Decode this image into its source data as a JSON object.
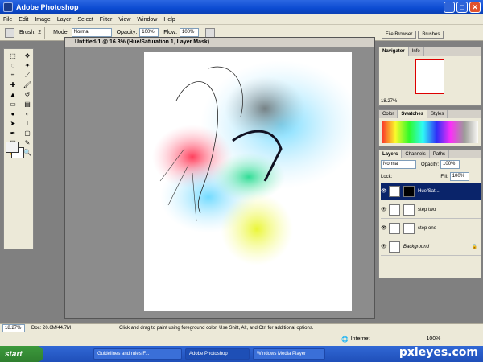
{
  "window": {
    "title": "Adobe Photoshop",
    "min": "_",
    "max": "□",
    "close": "✕"
  },
  "menu": [
    "File",
    "Edit",
    "Image",
    "Layer",
    "Select",
    "Filter",
    "View",
    "Window",
    "Help"
  ],
  "options": {
    "brush_label": "Brush:",
    "brush_size": "2",
    "mode_label": "Mode:",
    "mode_value": "Normal",
    "opacity_label": "Opacity:",
    "opacity_value": "100%",
    "flow_label": "Flow:",
    "flow_value": "100%"
  },
  "top_tabs": [
    "File Browser",
    "Brushes"
  ],
  "document": {
    "title": "Untitled-1 @ 16.3% (Hue/Saturation 1, Layer Mask)"
  },
  "navigator": {
    "tabs": [
      "Navigator",
      "Info"
    ],
    "zoom": "18.27%"
  },
  "color_panel": {
    "tabs": [
      "Color",
      "Swatches",
      "Styles"
    ]
  },
  "layers_panel": {
    "tabs": [
      "Layers",
      "Channels",
      "Paths"
    ],
    "blend": "Normal",
    "opacity_label": "Opacity:",
    "opacity": "100%",
    "lock_label": "Lock:",
    "fill_label": "Fill:",
    "fill": "100%",
    "layers": [
      {
        "name": "Hue/Sat..."
      },
      {
        "name": "step two"
      },
      {
        "name": "step one"
      },
      {
        "name": "Background"
      }
    ]
  },
  "status": {
    "zoom": "18.27%",
    "doc": "Doc: 20.6M/44.7M",
    "hint": "Click and drag to paint using foreground color. Use Shift, Alt, and Ctrl for additional options."
  },
  "ie": {
    "zone": "Internet",
    "zoom": "100%"
  },
  "taskbar": {
    "start": "start",
    "items": [
      "Guidelines and rules F...",
      "Adobe Photoshop",
      "Windows Media Player"
    ]
  },
  "watermark": "pxleyes.com",
  "colors": {
    "accent": "#0b4ad1",
    "taskbar": "#245edb"
  }
}
